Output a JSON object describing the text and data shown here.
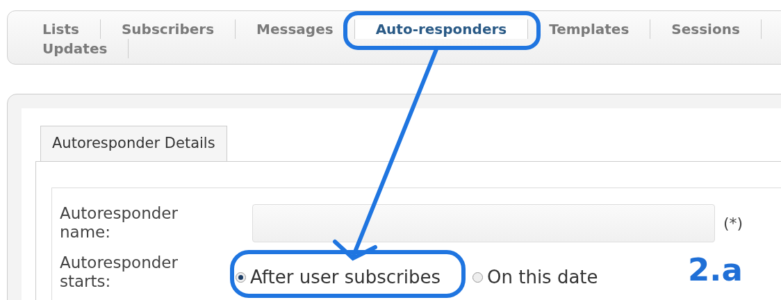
{
  "nav_tabs": [
    {
      "label": "Lists",
      "selected": false
    },
    {
      "label": "Subscribers",
      "selected": false
    },
    {
      "label": "Messages",
      "selected": false
    },
    {
      "label": "Auto-responders",
      "selected": true
    },
    {
      "label": "Templates",
      "selected": false
    },
    {
      "label": "Sessions",
      "selected": false
    },
    {
      "label": "Updates",
      "selected": false
    }
  ],
  "panel_tab": {
    "label": "Autoresponder Details"
  },
  "form": {
    "name_label": "Autoresponder name:",
    "required_mark": "(*)",
    "starts_label": "Autoresponder starts:",
    "start_options": [
      {
        "label": "After user subscribes",
        "selected": true
      },
      {
        "label": "On this date",
        "selected": false
      }
    ]
  },
  "annotation": {
    "label": "2.a"
  }
}
